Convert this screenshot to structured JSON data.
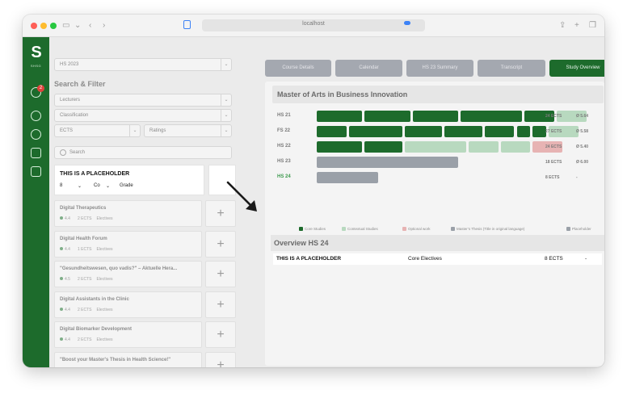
{
  "browser": {
    "url": "localhost"
  },
  "sidebar": {
    "logo": "S",
    "logo_sub": "SHSG",
    "badge_count": "2",
    "icons": [
      "bell-icon",
      "chat-icon",
      "shield-icon",
      "wallet-icon",
      "logout-icon"
    ]
  },
  "filters": {
    "semester": "HS 2023",
    "heading": "Search & Filter",
    "lecturers": "Lecturers",
    "classification": "Classification",
    "ects": "ECTS",
    "ratings": "Ratings",
    "search_placeholder": "Search"
  },
  "placeholder_card": {
    "title": "THIS IS A PLACEHOLDER",
    "credits": "8",
    "category": "Co",
    "grade_label": "Grade"
  },
  "courses": [
    {
      "title": "Digital Therapeutics",
      "rating": "4.4",
      "ects": "2 ECTS",
      "type": "Electives"
    },
    {
      "title": "Digital Health Forum",
      "rating": "4.4",
      "ects": "1 ECTS",
      "type": "Electives"
    },
    {
      "title": "\"Gesundheitswesen, quo vadis?\" – Aktuelle Hera...",
      "rating": "4.5",
      "ects": "2 ECTS",
      "type": "Electives"
    },
    {
      "title": "Digital Assistants in the Clinic",
      "rating": "4.4",
      "ects": "2 ECTS",
      "type": "Electives"
    },
    {
      "title": "Digital Biomarker Development",
      "rating": "4.4",
      "ects": "2 ECTS",
      "type": "Electives"
    },
    {
      "title": "\"Boost your Master's Thesis in Health Science!\"",
      "rating": "4.4",
      "ects": "2 ECTS",
      "type": "Electives"
    }
  ],
  "tabs": [
    {
      "label": "Course Details",
      "active": false
    },
    {
      "label": "Calendar",
      "active": false
    },
    {
      "label": "HS 23 Summary",
      "active": false
    },
    {
      "label": "Transcript",
      "active": false
    },
    {
      "label": "Study Overview",
      "active": true
    }
  ],
  "program": {
    "title": "Master of Arts in Business Innovation",
    "semesters": [
      {
        "label": "HS 21",
        "ects": "24 ECTS",
        "avg": "Ø 5.64",
        "blocks": [
          {
            "w": 6,
            "c": "core"
          },
          {
            "w": 6,
            "c": "core"
          },
          {
            "w": 6,
            "c": "core"
          },
          {
            "w": 8,
            "c": "core"
          },
          {
            "w": 4,
            "c": "core"
          },
          {
            "w": 4,
            "c": "ctx"
          }
        ]
      },
      {
        "label": "FS 22",
        "ects": "27 ECTS",
        "avg": "Ø 5.58",
        "blocks": [
          {
            "w": 4,
            "c": "core"
          },
          {
            "w": 7,
            "c": "core"
          },
          {
            "w": 5,
            "c": "core"
          },
          {
            "w": 5,
            "c": "core"
          },
          {
            "w": 4,
            "c": "core"
          },
          {
            "w": 2,
            "c": "core"
          },
          {
            "w": 2,
            "c": "core"
          },
          {
            "w": 4,
            "c": "ctx"
          }
        ]
      },
      {
        "label": "HS 22",
        "ects": "24 ECTS",
        "avg": "Ø 5.40",
        "blocks": [
          {
            "w": 6,
            "c": "core"
          },
          {
            "w": 5,
            "c": "core"
          },
          {
            "w": 8,
            "c": "ctx"
          },
          {
            "w": 4,
            "c": "ctx"
          },
          {
            "w": 4,
            "c": "ctx"
          },
          {
            "w": 4,
            "c": "opt"
          }
        ]
      },
      {
        "label": "HS 23",
        "ects": "18 ECTS",
        "avg": "Ø 6.00",
        "blocks": [
          {
            "w": 18,
            "c": "thesis"
          }
        ]
      },
      {
        "label": "HS 24",
        "ects": "8 ECTS",
        "avg": "-",
        "current": true,
        "blocks": [
          {
            "w": 8,
            "c": "placeholder"
          }
        ]
      }
    ]
  },
  "legend": [
    {
      "label": "Core Studies",
      "color": "#1d6b2c"
    },
    {
      "label": "Contextual Studies",
      "color": "#b8d9bf"
    },
    {
      "label": "Optional work",
      "color": "#e7b3b3"
    },
    {
      "label": "Master’s Thesis (Title in original language)",
      "color": "#9aa0a8"
    },
    {
      "label": "Placeholder",
      "color": "#9aa0a8"
    }
  ],
  "colors": {
    "core": "#1d6b2c",
    "ctx": "#b8d9bf",
    "opt": "#e7b3b3",
    "thesis": "#9aa0a8",
    "placeholder": "#9aa0a8"
  },
  "overview": {
    "title": "Overview HS 24",
    "row": {
      "name": "THIS IS A PLACEHOLDER",
      "type": "Core Electives",
      "ects": "8 ECTS",
      "grade": "-"
    }
  }
}
